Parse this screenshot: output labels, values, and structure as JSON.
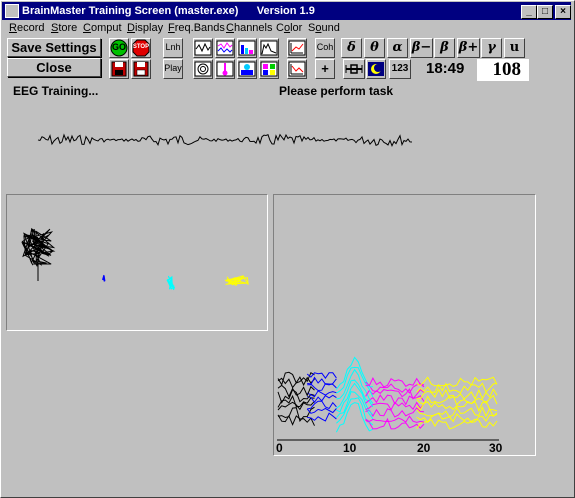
{
  "window": {
    "title": "BrainMaster Training Screen (master.exe)      Version 1.9"
  },
  "menu": [
    {
      "pre": "",
      "u": "R",
      "post": "ecord"
    },
    {
      "pre": "",
      "u": "S",
      "post": "tore"
    },
    {
      "pre": "",
      "u": "C",
      "post": "omput"
    },
    {
      "pre": "",
      "u": "D",
      "post": "isplay"
    },
    {
      "pre": "",
      "u": "F",
      "post": "req.Bands"
    },
    {
      "pre": "",
      "u": "C",
      "post": "hannels"
    },
    {
      "pre": "C",
      "u": "o",
      "post": "lor"
    },
    {
      "pre": "S",
      "u": "o",
      "post": "und"
    }
  ],
  "toolbar": {
    "save_label": "Save Settings",
    "close_label": "Close",
    "go_label": "GO",
    "stop_label": "STOP",
    "lnh_label": "Lnh",
    "play_label": "Play",
    "coh_label": "Coh",
    "plus_label": "+",
    "n123_label": "123",
    "greek": [
      "δ",
      "θ",
      "α",
      "β−",
      "β",
      "β+",
      "γ",
      "u"
    ]
  },
  "status": {
    "left": "EEG Training...",
    "right": "Please perform task"
  },
  "clock": "18:49",
  "score": "108",
  "spectrum_axis": [
    "0",
    "10",
    "20",
    "30"
  ],
  "colors": {
    "title_bar": "#000080",
    "face": "#c0c0c0",
    "series_black": "#000000",
    "series_blue": "#0000ff",
    "series_cyan": "#00ffff",
    "series_magenta": "#ff00ff",
    "series_yellow": "#ffff00",
    "go_green": "#00c000",
    "stop_red": "#e00000"
  }
}
